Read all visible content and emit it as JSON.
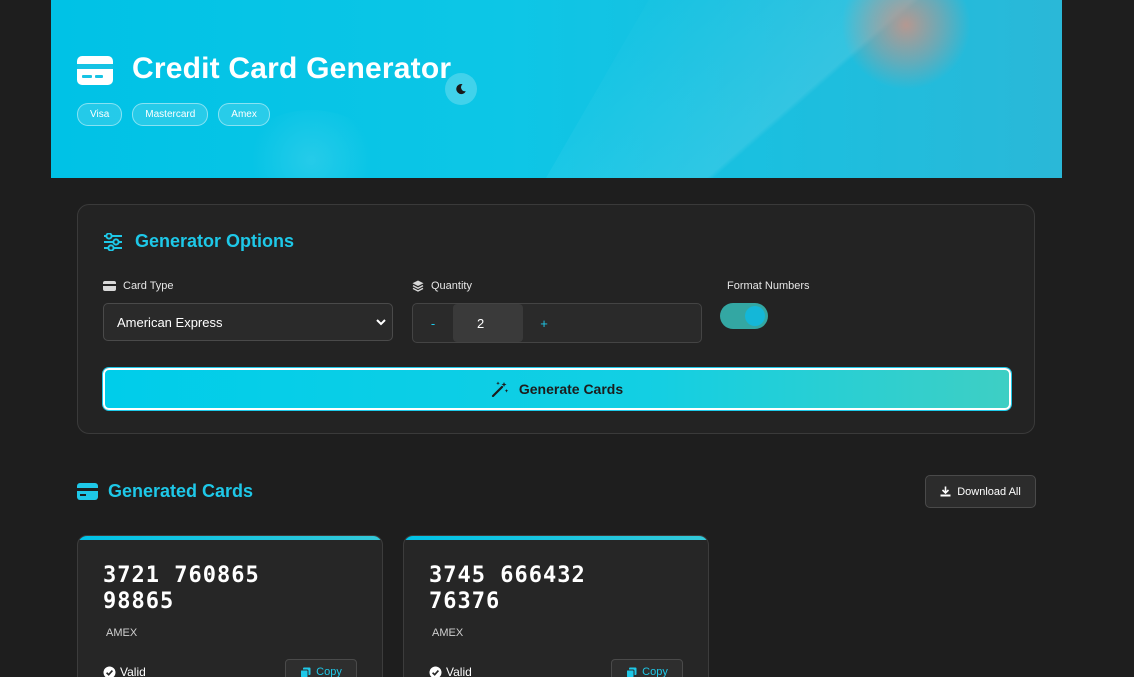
{
  "header": {
    "title": "Credit Card Generator",
    "tags": [
      "Visa",
      "Mastercard",
      "Amex"
    ],
    "theme_icon": "moon-icon",
    "accent": "#00c2e6"
  },
  "options": {
    "title": "Generator Options",
    "card_type": {
      "label": "Card Type",
      "selected": "American Express"
    },
    "quantity": {
      "label": "Quantity",
      "minus": "-",
      "value": "2",
      "plus": "+"
    },
    "format": {
      "label": "Format Numbers",
      "enabled": true
    },
    "generate_label": "Generate Cards"
  },
  "results": {
    "title": "Generated Cards",
    "download_label": "Download All",
    "cards": [
      {
        "number": "3721 760865 98865",
        "brand": "AMEX",
        "status": "Valid",
        "copy_label": "Copy"
      },
      {
        "number": "3745 666432 76376",
        "brand": "AMEX",
        "status": "Valid",
        "copy_label": "Copy"
      }
    ]
  },
  "colors": {
    "background": "#1e1e1e",
    "panel": "#232323",
    "accent_text": "#1ec8e8",
    "toggle_on": "#33a7a3"
  }
}
